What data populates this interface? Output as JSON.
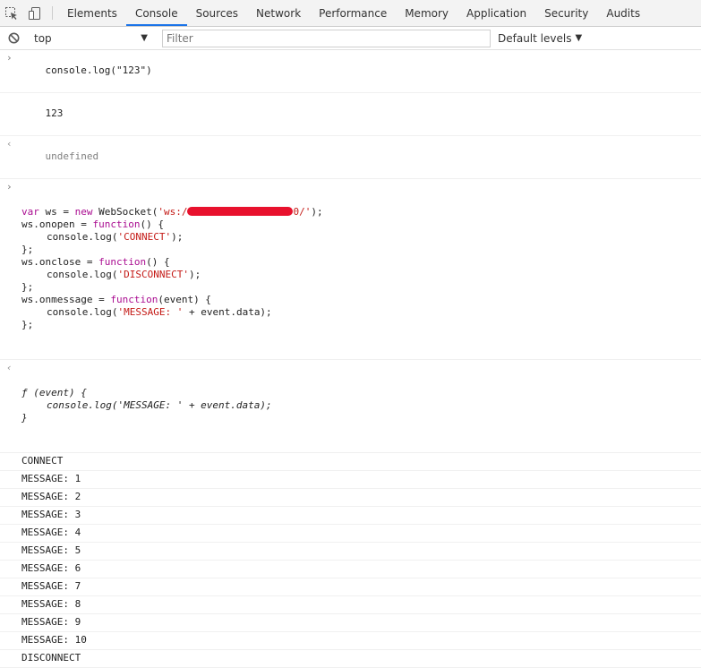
{
  "tabs": [
    "Elements",
    "Console",
    "Sources",
    "Network",
    "Performance",
    "Memory",
    "Application",
    "Security",
    "Audits"
  ],
  "active_tab": "Console",
  "filterbar": {
    "context": "top",
    "filter_placeholder": "Filter",
    "levels": "Default levels"
  },
  "console": {
    "cmd1": "console.log(\"123\")",
    "out1": "123",
    "res1": "undefined",
    "code": {
      "l1_a": "var",
      "l1_b": " ws = ",
      "l1_c": "new",
      "l1_d": " WebSocket(",
      "l1_e": "'ws:/",
      "l1_f": "0/'",
      "l1_g": ");",
      "l2_a": "ws.onopen = ",
      "l2_b": "function",
      "l2_c": "() {",
      "l3_a": "console.log(",
      "l3_b": "'CONNECT'",
      "l3_c": ");",
      "l4": "};",
      "l5_a": "ws.onclose = ",
      "l5_b": "function",
      "l5_c": "() {",
      "l6_a": "console.log(",
      "l6_b": "'DISCONNECT'",
      "l6_c": ");",
      "l7": "};",
      "l8_a": "ws.onmessage = ",
      "l8_b": "function",
      "l8_c": "(event) {",
      "l9_a": "console.log(",
      "l9_b": "'MESSAGE: '",
      "l9_c": " + event.data);",
      "l10": "};"
    },
    "ret": {
      "l1": "ƒ (event) {",
      "l2": "console.log('MESSAGE: ' + event.data);",
      "l3": "}"
    },
    "logs": [
      "CONNECT",
      "MESSAGE: 1",
      "MESSAGE: 2",
      "MESSAGE: 3",
      "MESSAGE: 4",
      "MESSAGE: 5",
      "MESSAGE: 6",
      "MESSAGE: 7",
      "MESSAGE: 8",
      "MESSAGE: 9",
      "MESSAGE: 10",
      "DISCONNECT"
    ]
  },
  "colors": {
    "keyword": "#aa0d91",
    "string": "#c41a16",
    "redaction": "#e8112d",
    "active_tab_underline": "#1a73e8"
  }
}
